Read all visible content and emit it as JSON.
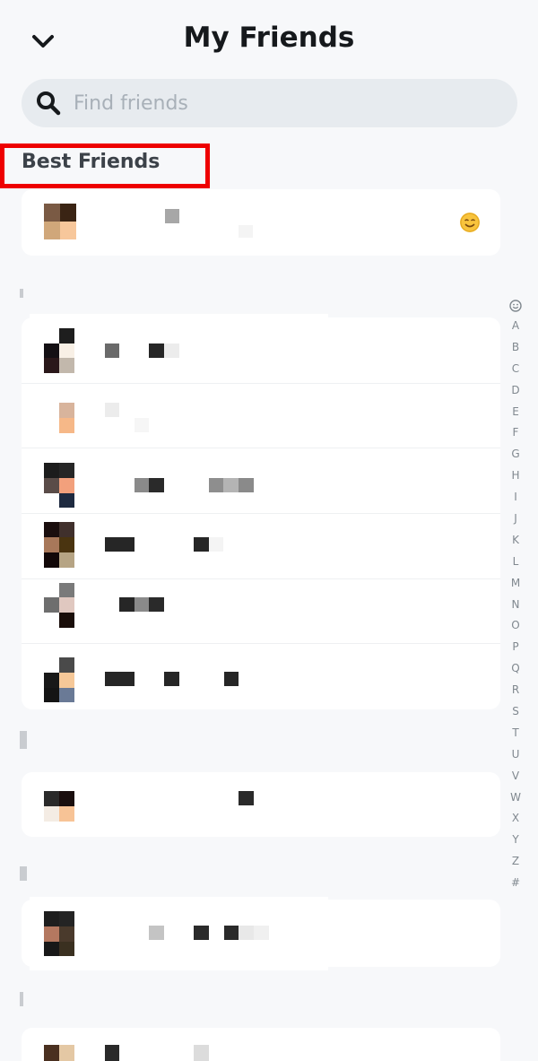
{
  "header": {
    "title": "My Friends",
    "back_icon": "chevron-down-icon"
  },
  "search": {
    "placeholder": "Find friends",
    "icon": "search-icon"
  },
  "best_friends": {
    "label": "Best Friends",
    "highlight_color": "#ee0000"
  },
  "alphabet_index": [
    "A",
    "B",
    "C",
    "D",
    "E",
    "F",
    "G",
    "H",
    "I",
    "J",
    "K",
    "L",
    "M",
    "N",
    "O",
    "P",
    "Q",
    "R",
    "S",
    "T",
    "U",
    "V",
    "W",
    "X",
    "Y",
    "Z",
    "#"
  ],
  "colors": {
    "background": "#f7f8fa",
    "card": "#ffffff",
    "search_bg": "#e7ebef",
    "emoji": "#f8c33c"
  },
  "best_friend_emoji": "smiling-face-emoji"
}
